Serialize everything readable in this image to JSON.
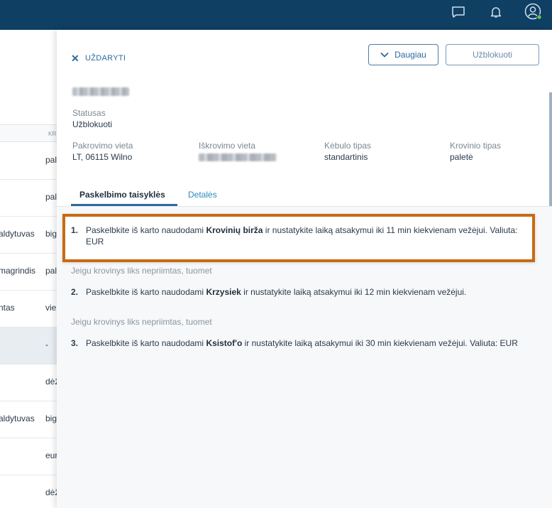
{
  "topbar": {
    "icons": [
      "chat-icon",
      "bell-icon",
      "user-icon"
    ],
    "status_dot_color": "#6cc24a"
  },
  "background_list": {
    "header_col": "KR",
    "rows": [
      {
        "c1": "",
        "c2": "pal"
      },
      {
        "c1": "",
        "c2": "pal"
      },
      {
        "c1": "aldytuvas",
        "c2": "big"
      },
      {
        "c1": "magrindis",
        "c2": "pal"
      },
      {
        "c1": "ntas",
        "c2": "vie"
      },
      {
        "c1": "",
        "c2": "-"
      },
      {
        "c1": "",
        "c2": "dėž"
      },
      {
        "c1": "aldytuvas",
        "c2": "big"
      },
      {
        "c1": "",
        "c2": "eur"
      },
      {
        "c1": "",
        "c2": "dėž"
      }
    ]
  },
  "panel": {
    "close_label": "UŽDARYTI",
    "more_label": "Daugiau",
    "unblock_label": "Užblokuoti",
    "status_label": "Statusas",
    "status_value": "Užblokuoti",
    "fields": {
      "loading_label": "Pakrovimo vieta",
      "loading_value": "LT, 06115 Wilno",
      "unloading_label": "Iškrovimo vieta",
      "body_label": "Kėbulo tipas",
      "body_value": "standartinis",
      "cargo_label": "Krovinio tipas",
      "cargo_value": "paletė"
    },
    "tabs": {
      "rules": "Paskelbimo taisyklės",
      "details": "Detalės"
    },
    "rules": [
      {
        "num": "1.",
        "pre": "Paskelbkite iš karto naudodami ",
        "bold": "Krovinių birža",
        "post": " ir nustatykite laiką atsakymui iki 11 min kiekvienam vežėjui. Valiuta: EUR"
      },
      {
        "num": "2.",
        "pre": "Paskelbkite iš karto naudodami ",
        "bold": "Krzysiek",
        "post": " ir nustatykite laiką atsakymui iki 12 min kiekvienam vežėjui."
      },
      {
        "num": "3.",
        "pre": "Paskelbkite iš karto naudodami ",
        "bold": "Ksistof'o",
        "post": " ir nustatykite laiką atsakymui iki 30 min kiekvienam vežėjui. Valiuta: EUR"
      }
    ],
    "condition_text": "Jeigu krovinys liks nepriimtas, tuomet",
    "highlight_color": "#c96a12"
  }
}
